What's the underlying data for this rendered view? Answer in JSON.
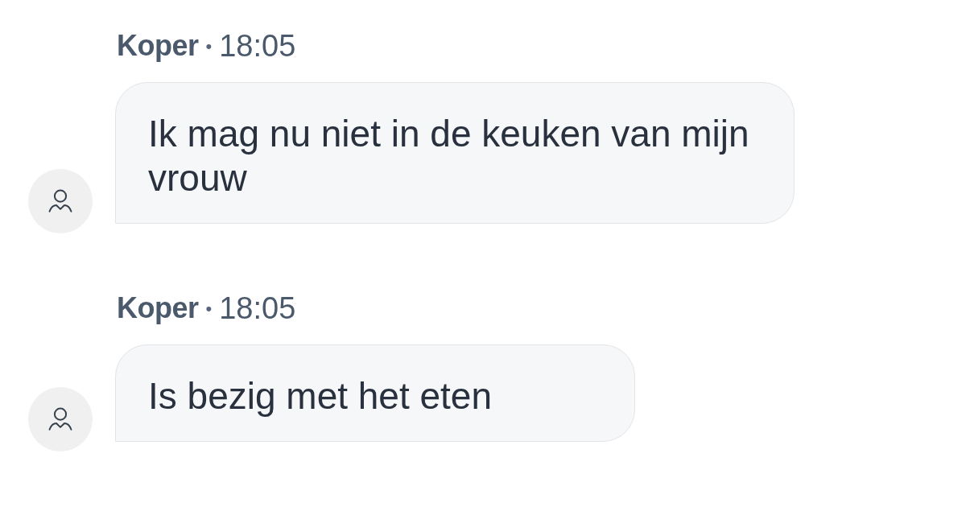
{
  "messages": [
    {
      "sender": "Koper",
      "separator": "•",
      "time": "18:05",
      "text": "Ik mag nu niet in de keuken van mijn vrouw"
    },
    {
      "sender": "Koper",
      "separator": "•",
      "time": "18:05",
      "text": "Is bezig met het eten"
    }
  ]
}
